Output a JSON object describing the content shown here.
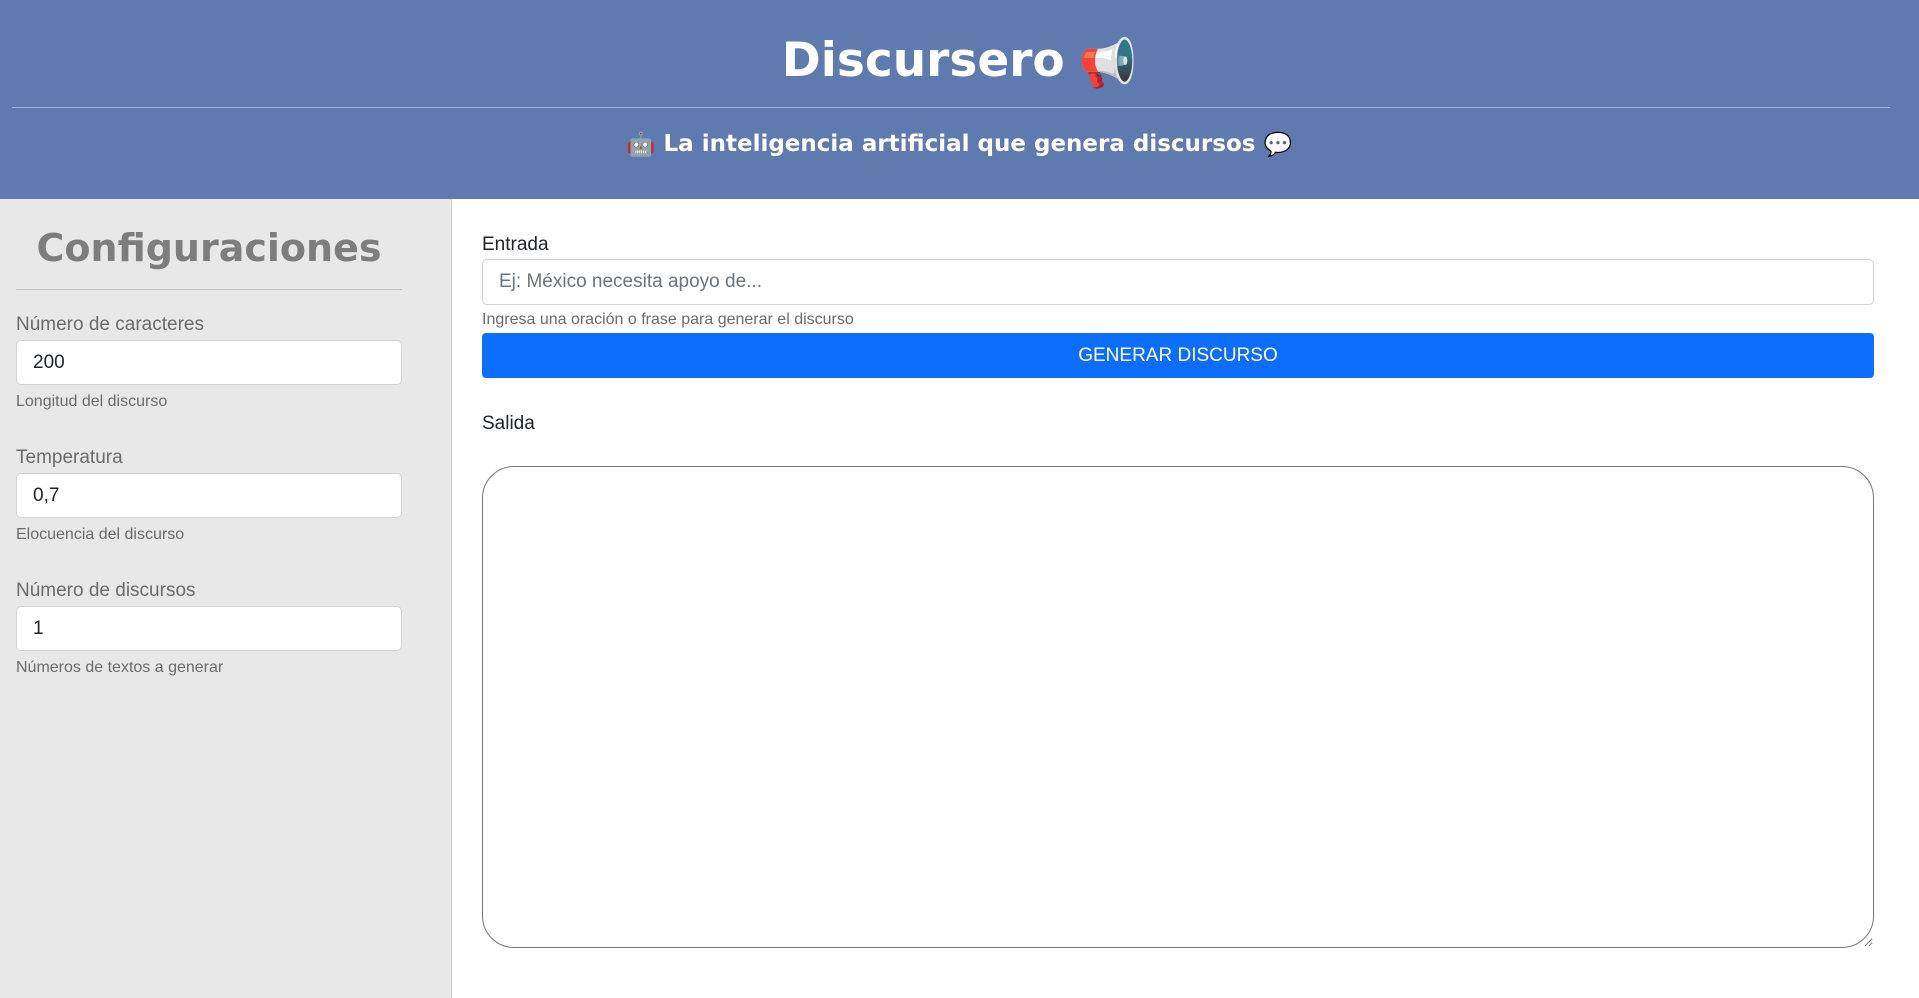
{
  "header": {
    "title": "Discursero",
    "title_emoji": "📢",
    "subtitle": "La inteligencia artificial que genera discursos",
    "subtitle_left_emoji": "🤖",
    "subtitle_right_emoji": "💬",
    "background_color": "#5f7aae"
  },
  "sidebar": {
    "title": "Configuraciones",
    "fields": [
      {
        "label": "Número de caracteres",
        "value": "200",
        "help": "Longitud del discurso"
      },
      {
        "label": "Temperatura",
        "value": "0,7",
        "help": "Elocuencia del discurso"
      },
      {
        "label": "Número de discursos",
        "value": "1",
        "help": "Números de textos a generar"
      }
    ]
  },
  "main": {
    "entrada": {
      "label": "Entrada",
      "placeholder": "Ej: México necesita apoyo de...",
      "value": "",
      "help": "Ingresa una oración o frase para generar el discurso"
    },
    "generate_button": "GENERAR DISCURSO",
    "salida": {
      "label": "Salida",
      "value": ""
    }
  },
  "colors": {
    "accent": "#0d6efd",
    "sidebar_bg": "#e8e8e8"
  }
}
